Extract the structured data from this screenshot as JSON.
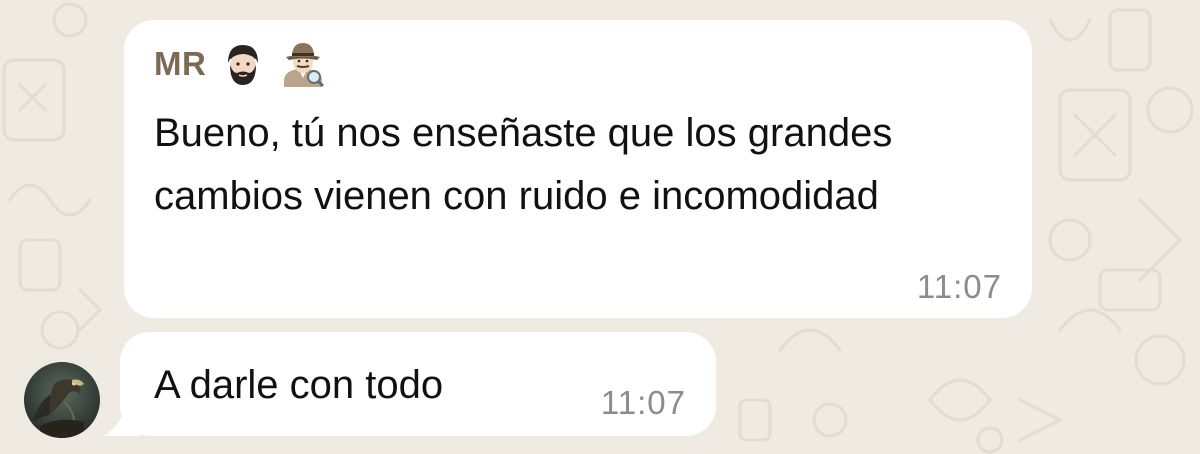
{
  "chat": {
    "messages": [
      {
        "sender": "MR",
        "sender_emojis": [
          "man-beard-icon",
          "detective-icon"
        ],
        "text": "Bueno, tú nos enseñaste que los grandes cambios vienen con ruido e incomodidad",
        "time": "11:07"
      },
      {
        "text": "A darle con todo",
        "time": "11:07",
        "avatar": "eagle-avatar"
      }
    ]
  },
  "colors": {
    "background": "#efeae2",
    "bubble": "#ffffff",
    "sender_name": "#7d6a55",
    "timestamp": "#8c8c8c"
  }
}
